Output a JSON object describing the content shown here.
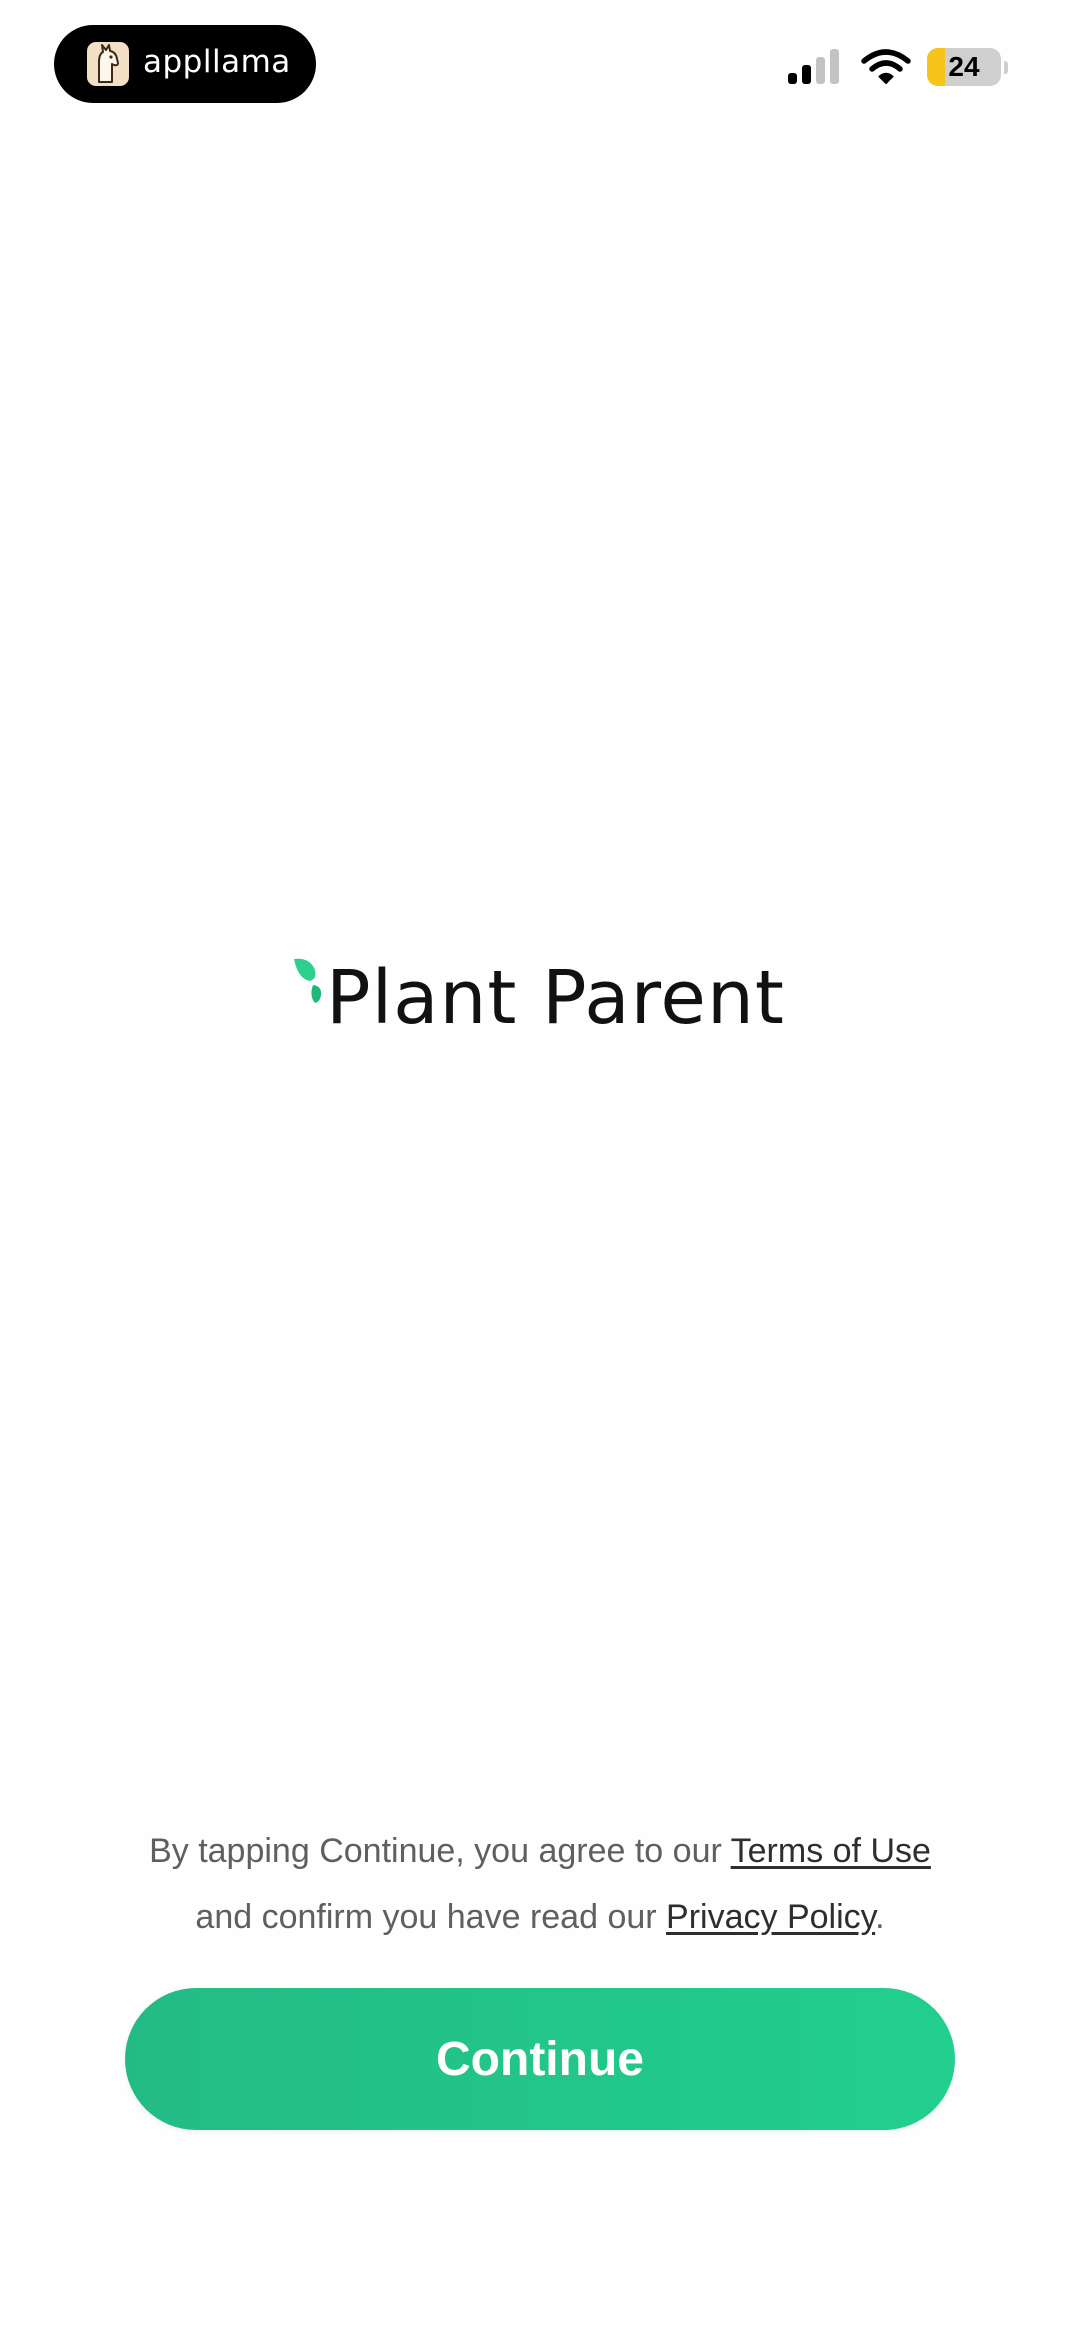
{
  "status_bar": {
    "app_name": "appllama",
    "battery_level": "24",
    "battery_fraction": 0.24,
    "icons": [
      "llama-icon",
      "signal-icon",
      "wifi-icon",
      "battery-icon"
    ]
  },
  "logo": {
    "icon": "leaf-icon",
    "text": "Plant Parent",
    "leaf_color": "#2fd08e"
  },
  "consent": {
    "line1_prefix": "By tapping Continue, you agree to our ",
    "terms_link": "Terms of Use",
    "line2_prefix": "and confirm you have read our ",
    "privacy_link": "Privacy Policy",
    "line2_suffix": "."
  },
  "continue_button": {
    "label": "Continue",
    "color": "#22c58a"
  }
}
